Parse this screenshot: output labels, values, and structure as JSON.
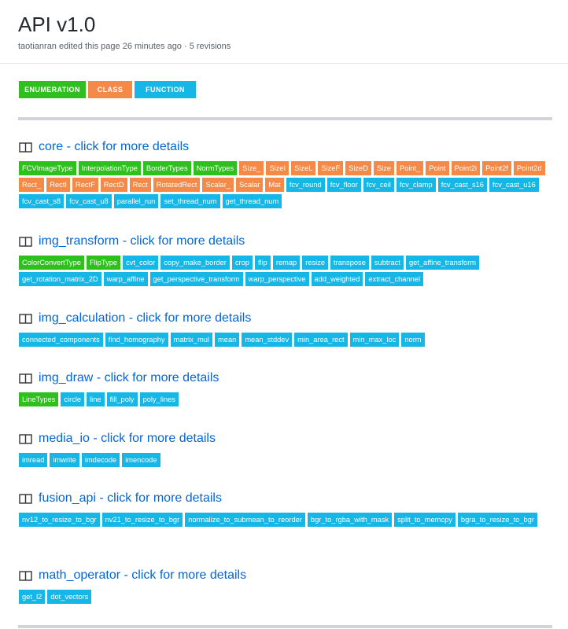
{
  "page": {
    "title": "API v1.0",
    "meta": "taotianran edited this page 26 minutes ago · 5 revisions"
  },
  "legend": {
    "enumeration": "ENUMERATION",
    "class": "CLASS",
    "function": "FUNCTION"
  },
  "colors": {
    "enumeration": "#2fbf1f",
    "class": "#f58a48",
    "function": "#16b6e6",
    "link": "#0366d6"
  },
  "sections": [
    {
      "title": "core - click for more details",
      "icon": "book-icon",
      "items": [
        {
          "label": "FCVImageType",
          "kind": "enum"
        },
        {
          "label": "InterpolationType",
          "kind": "enum"
        },
        {
          "label": "BorderTypes",
          "kind": "enum"
        },
        {
          "label": "NormTypes",
          "kind": "enum"
        },
        {
          "label": "Size_",
          "kind": "class"
        },
        {
          "label": "SizeI",
          "kind": "class"
        },
        {
          "label": "SizeL",
          "kind": "class"
        },
        {
          "label": "SizeF",
          "kind": "class"
        },
        {
          "label": "SizeD",
          "kind": "class"
        },
        {
          "label": "Size",
          "kind": "class"
        },
        {
          "label": "Point_",
          "kind": "class"
        },
        {
          "label": "Point",
          "kind": "class"
        },
        {
          "label": "Point2i",
          "kind": "class"
        },
        {
          "label": "Point2f",
          "kind": "class"
        },
        {
          "label": "Point2d",
          "kind": "class"
        },
        {
          "label": "Rect_",
          "kind": "class"
        },
        {
          "label": "RectI",
          "kind": "class"
        },
        {
          "label": "RectF",
          "kind": "class"
        },
        {
          "label": "RectD",
          "kind": "class"
        },
        {
          "label": "Rect",
          "kind": "class"
        },
        {
          "label": "RotatedRect",
          "kind": "class"
        },
        {
          "label": "Scalar_",
          "kind": "class"
        },
        {
          "label": "Scalar",
          "kind": "class"
        },
        {
          "label": "Mat",
          "kind": "class"
        },
        {
          "label": "fcv_round",
          "kind": "func"
        },
        {
          "label": "fcv_floor",
          "kind": "func"
        },
        {
          "label": "fcv_ceil",
          "kind": "func"
        },
        {
          "label": "fcv_clamp",
          "kind": "func"
        },
        {
          "label": "fcv_cast_s16",
          "kind": "func"
        },
        {
          "label": "fcv_cast_u16",
          "kind": "func"
        },
        {
          "label": "fcv_cast_s8",
          "kind": "func"
        },
        {
          "label": "fcv_cast_u8",
          "kind": "func"
        },
        {
          "label": "parallel_run",
          "kind": "func"
        },
        {
          "label": "set_thread_num",
          "kind": "func"
        },
        {
          "label": "get_thread_num",
          "kind": "func"
        }
      ]
    },
    {
      "title": "img_transform - click for more details",
      "icon": "book-icon",
      "items": [
        {
          "label": "ColorConvertType",
          "kind": "enum"
        },
        {
          "label": "FlipType",
          "kind": "enum"
        },
        {
          "label": "cvt_color",
          "kind": "func"
        },
        {
          "label": "copy_make_border",
          "kind": "func"
        },
        {
          "label": "crop",
          "kind": "func"
        },
        {
          "label": "flip",
          "kind": "func"
        },
        {
          "label": "remap",
          "kind": "func"
        },
        {
          "label": "resize",
          "kind": "func"
        },
        {
          "label": "transpose",
          "kind": "func"
        },
        {
          "label": "subtract",
          "kind": "func"
        },
        {
          "label": "get_affine_transform",
          "kind": "func"
        },
        {
          "label": "get_rotation_matrix_2D",
          "kind": "func"
        },
        {
          "label": "warp_affine",
          "kind": "func"
        },
        {
          "label": "get_perspective_transform",
          "kind": "func"
        },
        {
          "label": "warp_perspective",
          "kind": "func"
        },
        {
          "label": "add_weighted",
          "kind": "func"
        },
        {
          "label": "extract_channel",
          "kind": "func"
        }
      ]
    },
    {
      "title": "img_calculation - click for more details",
      "icon": "book-icon",
      "items": [
        {
          "label": "connected_components",
          "kind": "func"
        },
        {
          "label": "find_homography",
          "kind": "func"
        },
        {
          "label": "matrix_mul",
          "kind": "func"
        },
        {
          "label": "mean",
          "kind": "func"
        },
        {
          "label": "mean_stddev",
          "kind": "func"
        },
        {
          "label": "min_area_rect",
          "kind": "func"
        },
        {
          "label": "min_max_loc",
          "kind": "func"
        },
        {
          "label": "norm",
          "kind": "func"
        }
      ]
    },
    {
      "title": "img_draw - click for more details",
      "icon": "book-icon",
      "items": [
        {
          "label": "LineTypes",
          "kind": "enum"
        },
        {
          "label": "circle",
          "kind": "func"
        },
        {
          "label": "line",
          "kind": "func"
        },
        {
          "label": "fill_poly",
          "kind": "func"
        },
        {
          "label": "poly_lines",
          "kind": "func"
        }
      ]
    },
    {
      "title": "media_io - click for more details",
      "icon": "book-icon",
      "items": [
        {
          "label": "imread",
          "kind": "func"
        },
        {
          "label": "imwrite",
          "kind": "func"
        },
        {
          "label": "imdecode",
          "kind": "func"
        },
        {
          "label": "imencode",
          "kind": "func"
        }
      ]
    },
    {
      "title": "fusion_api - click for more details",
      "icon": "book-icon",
      "items": [
        {
          "label": "nv12_to_resize_to_bgr",
          "kind": "func"
        },
        {
          "label": "nv21_to_resize_to_bgr",
          "kind": "func"
        },
        {
          "label": "normalize_to_submean_to_reorder",
          "kind": "func"
        },
        {
          "label": "bgr_to_rgba_with_mask",
          "kind": "func"
        },
        {
          "label": "split_to_memcpy",
          "kind": "func"
        },
        {
          "label": "bgra_to_resize_to_bgr",
          "kind": "func"
        }
      ]
    },
    {
      "title": "math_operator - click for more details",
      "icon": "book-icon",
      "items": [
        {
          "label": "get_l2",
          "kind": "func"
        },
        {
          "label": "dot_vectors",
          "kind": "func"
        }
      ]
    }
  ]
}
